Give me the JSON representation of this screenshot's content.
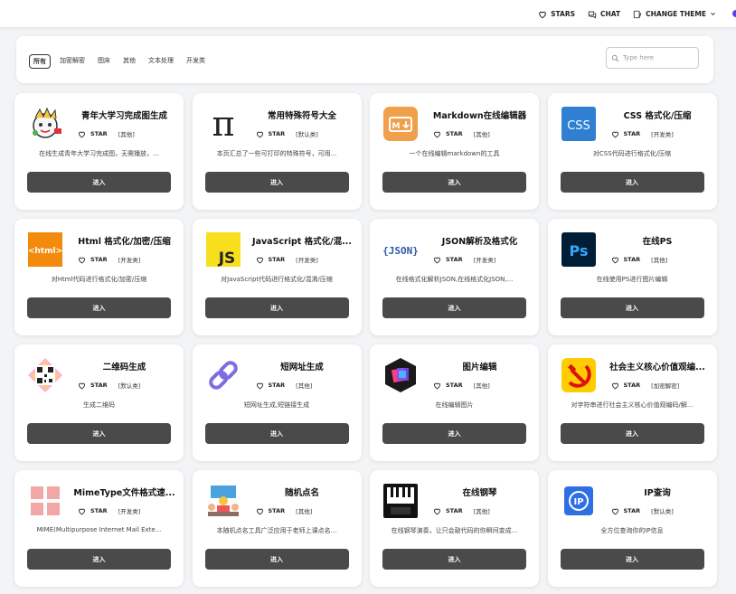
{
  "nav": {
    "stars": "STARS",
    "chat": "CHAT",
    "theme": "CHANGE THEME"
  },
  "filters": {
    "tabs": [
      "所有",
      "加密解密",
      "图床",
      "其他",
      "文本处理",
      "开发类"
    ],
    "active_index": 0,
    "search_placeholder": "Type here"
  },
  "card_common": {
    "star_label": "STAR",
    "enter_label": "进入"
  },
  "cards": [
    {
      "title": "青年大学习完成图生成",
      "category": "[其他]",
      "desc": "在线生成青年大学习完成图，无需播放，...",
      "icon": "mascot-icon"
    },
    {
      "title": "常用特殊符号大全",
      "category": "[默认类]",
      "desc": "本页汇总了一些可打印的特殊符号，可用...",
      "icon": "pi-icon"
    },
    {
      "title": "Markdown在线编辑器",
      "category": "[其他]",
      "desc": "一个在线编辑markdown的工具",
      "icon": "markdown-icon"
    },
    {
      "title": "CSS 格式化/压缩",
      "category": "[开发类]",
      "desc": "对CSS代码进行格式化/压缩",
      "icon": "css-icon"
    },
    {
      "title": "Html 格式化/加密/压缩",
      "category": "[开发类]",
      "desc": "对Html代码进行格式化/加密/压缩",
      "icon": "html-icon"
    },
    {
      "title": "JavaScript 格式化/混...",
      "category": "[开发类]",
      "desc": "对JavaScript代码进行格式化/混淆/压缩",
      "icon": "js-icon"
    },
    {
      "title": "JSON解析及格式化",
      "category": "[开发类]",
      "desc": "在线格式化解析JSON,在线格式化JSON,...",
      "icon": "json-icon"
    },
    {
      "title": "在线PS",
      "category": "[其他]",
      "desc": "在线使用PS进行图片编辑",
      "icon": "ps-icon"
    },
    {
      "title": "二维码生成",
      "category": "[默认类]",
      "desc": "生成二维码",
      "icon": "qrcode-icon"
    },
    {
      "title": "短网址生成",
      "category": "[其他]",
      "desc": "短网址生成,短链接生成",
      "icon": "link-icon"
    },
    {
      "title": "图片编辑",
      "category": "[其他]",
      "desc": "在线编辑图片",
      "icon": "image-editor-icon"
    },
    {
      "title": "社会主义核心价值观编...",
      "category": "[加密解密]",
      "desc": "对字符串进行社会主义核心价值观编码/解...",
      "icon": "hammer-sickle-icon"
    },
    {
      "title": "MimeType文件格式速...",
      "category": "[开发类]",
      "desc": "MIME(Multipurpose Internet Mail Exte...",
      "icon": "grid-icon"
    },
    {
      "title": "随机点名",
      "category": "[其他]",
      "desc": "本随机点名工具广泛应用于老师上课点名...",
      "icon": "classroom-icon"
    },
    {
      "title": "在线钢琴",
      "category": "[其他]",
      "desc": "在线钢琴演奏，让只会敲代码的你瞬间变成...",
      "icon": "piano-icon"
    },
    {
      "title": "IP查询",
      "category": "[默认类]",
      "desc": "全方位查询你的IP信息",
      "icon": "ip-icon"
    }
  ]
}
